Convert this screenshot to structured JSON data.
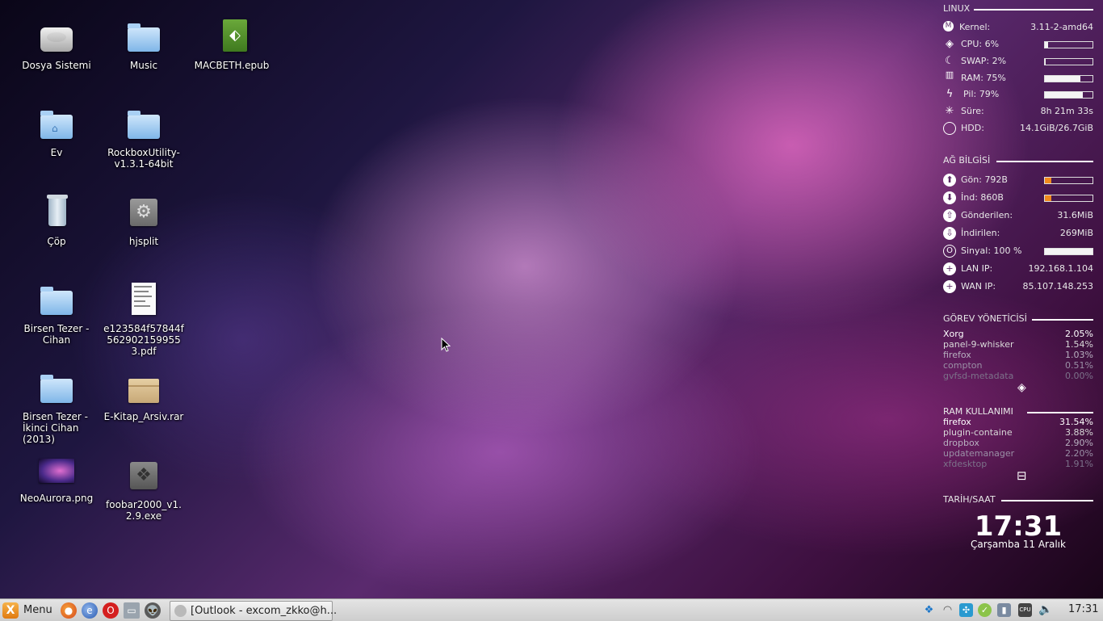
{
  "desktop": {
    "icons": [
      {
        "label": "Dosya Sistemi"
      },
      {
        "label": "Music"
      },
      {
        "label": "MACBETH.epub"
      },
      {
        "label": "Ev"
      },
      {
        "label": "RockboxUtility-v1.3.1-64bit"
      },
      {
        "label": "Çöp"
      },
      {
        "label": "hjsplit"
      },
      {
        "label": "Birsen Tezer - Cihan"
      },
      {
        "label": "e123584f57844f5629021599553.pdf"
      },
      {
        "label": "Birsen Tezer - İkinci Cihan (2013)"
      },
      {
        "label": "E-Kitap_Arsiv.rar"
      },
      {
        "label": "NeoAurora.png"
      },
      {
        "label": "foobar2000_v1.2.9.exe"
      }
    ]
  },
  "conky": {
    "linux": {
      "title": "LINUX",
      "kernel_label": "Kernel:",
      "kernel_value": "3.11-2-amd64",
      "cpu_label": "CPU:",
      "cpu_value": "6%",
      "cpu_pct": 6,
      "swap_label": "SWAP:",
      "swap_value": "2%",
      "swap_pct": 2,
      "ram_label": "RAM:",
      "ram_value": "75%",
      "ram_pct": 75,
      "pil_label": "Pil:",
      "pil_value": "79%",
      "pil_pct": 79,
      "sure_label": "Süre:",
      "sure_value": "8h 21m 33s",
      "hdd_label": "HDD:",
      "hdd_value": "14.1GiB/26.7GiB"
    },
    "net": {
      "title": "AĞ BİLGİSİ",
      "gon_label": "Gön:",
      "gon_value": "792B",
      "ind_label": "İnd:",
      "ind_value": "860B",
      "gonderilen_label": "Gönderilen:",
      "gonderilen_value": "31.6MiB",
      "indirilen_label": "İndirilen:",
      "indirilen_value": "269MiB",
      "sinyal_label": "Sinyal:",
      "sinyal_value": "100",
      "sinyal_unit": "%",
      "sinyal_pct": 100,
      "lan_label": "LAN IP:",
      "lan_value": "192.168.1.104",
      "wan_label": "WAN IP:",
      "wan_value": "85.107.148.253"
    },
    "tasks": {
      "title": "GÖREV YÖNETİCİSİ",
      "procs": [
        {
          "name": "Xorg",
          "value": "2.05%"
        },
        {
          "name": "panel-9-whisker",
          "value": "1.54%"
        },
        {
          "name": "firefox",
          "value": "1.03%"
        },
        {
          "name": "compton",
          "value": "0.51%"
        },
        {
          "name": "gvfsd-metadata",
          "value": "0.00%"
        }
      ]
    },
    "ram": {
      "title": "RAM KULLANIMI",
      "procs": [
        {
          "name": "firefox",
          "value": "31.54%"
        },
        {
          "name": "plugin-containe",
          "value": "3.88%"
        },
        {
          "name": "dropbox",
          "value": "2.90%"
        },
        {
          "name": "updatemanager",
          "value": "2.20%"
        },
        {
          "name": "xfdesktop",
          "value": "1.91%"
        }
      ]
    },
    "datetime": {
      "title": "TARİH/SAAT",
      "time": "17:31",
      "date": "Çarşamba 11 Aralık"
    }
  },
  "taskbar": {
    "menu_label": "Menu",
    "task_label": "[Outlook - excom_zkko@h...",
    "clock": "17:31",
    "launchers": [
      "firefox-icon",
      "internet-icon",
      "opera-icon",
      "file-manager-icon",
      "alien-icon"
    ],
    "tray": [
      "dropbox-icon",
      "wifi-icon",
      "puzzle-icon",
      "shield-icon",
      "battery-icon",
      "cpu-icon",
      "volume-icon"
    ]
  },
  "colors": {
    "net_bar": "#f08a1c",
    "panel_bg": "#d6d6d6"
  }
}
